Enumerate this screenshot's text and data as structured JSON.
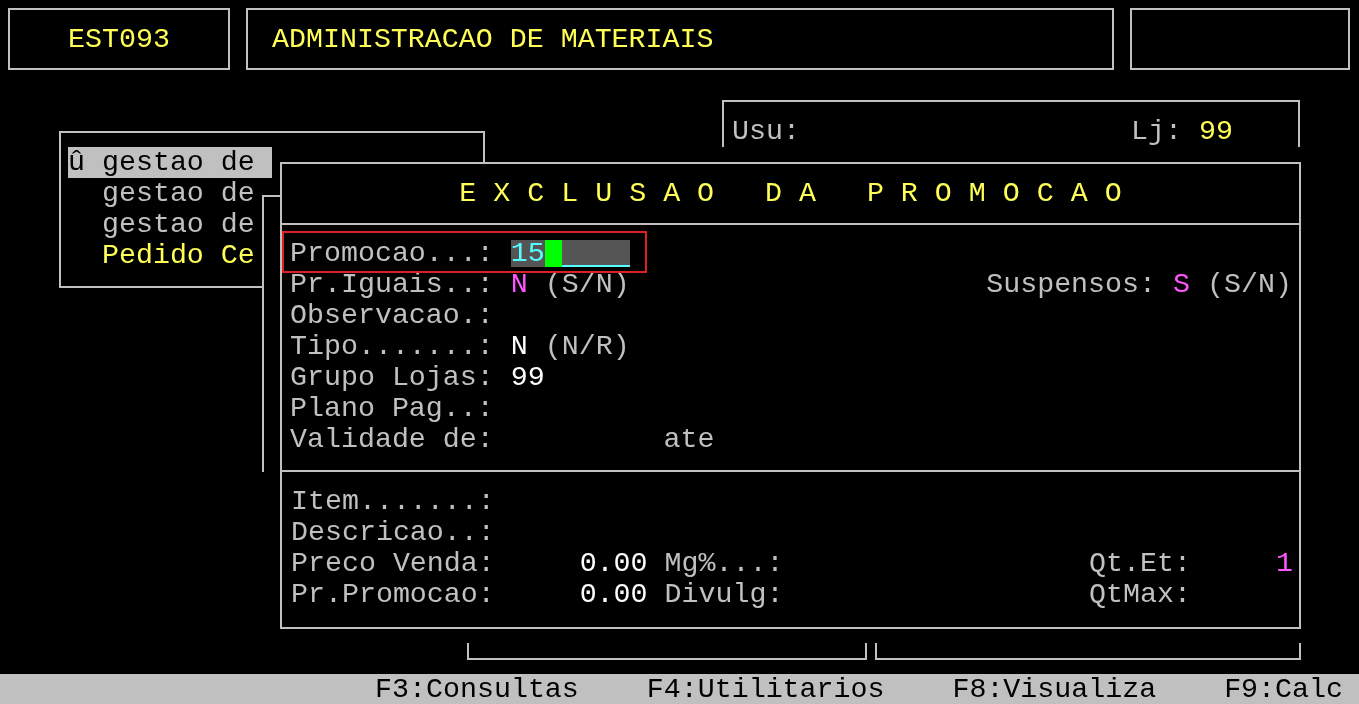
{
  "header": {
    "program_code": "EST093",
    "title": "ADMINISTRACAO DE MATERIAIS"
  },
  "user_panel": {
    "user_label": "Usu:",
    "store_label": "Lj:",
    "store_value": "99"
  },
  "menu": {
    "items": [
      {
        "marker": "û",
        "text": "gestao de",
        "selected": true
      },
      {
        "text": "gestao de",
        "selected": false,
        "color": "#c0c0c0"
      },
      {
        "text": "gestao de",
        "selected": false,
        "color": "#c0c0c0"
      },
      {
        "text": "Pedido Ce",
        "selected": false,
        "color": "#ffff55"
      }
    ]
  },
  "dialog": {
    "title": "E X C L U S A O   D A   P R O M O C A O",
    "header_rows": [
      {
        "label": "Promocao...:",
        "kind": "input",
        "value": "15",
        "focused": true
      },
      {
        "label": "Pr.Iguais..:",
        "kind": "flag",
        "value": "N",
        "color": "#ff55ff",
        "hint": "(S/N)",
        "right": {
          "label": "Suspensos:",
          "value": "S",
          "color": "#ff55ff",
          "hint": "(S/N)"
        }
      },
      {
        "label": "Observacao.:",
        "kind": "text"
      },
      {
        "label": "Tipo.......:",
        "kind": "flag",
        "value": "N",
        "color": "#ffffff",
        "hint": "(N/R)"
      },
      {
        "label": "Grupo Lojas:",
        "kind": "text",
        "value": "99"
      },
      {
        "label": "Plano Pag..:",
        "kind": "text"
      },
      {
        "label": "Validade de:",
        "kind": "text",
        "middle": {
          "label": "ate"
        }
      }
    ],
    "item_rows": [
      {
        "label": "Item.......:"
      },
      {
        "label": "Descricao..:"
      },
      {
        "label": "Preco Venda:",
        "value": "0.00",
        "middle": {
          "label": "Mg%...:"
        },
        "right": {
          "label": "Qt.Et:",
          "value": "1",
          "color": "#ff55ff"
        }
      },
      {
        "label": "Pr.Promocao:",
        "value": "0.00",
        "middle": {
          "label": "Divulg:"
        },
        "right": {
          "label": "QtMax:"
        }
      }
    ]
  },
  "function_keys": [
    "F3:Consultas",
    "F4:Utilitarios",
    "F8:Visualiza",
    "F9:Calc"
  ]
}
